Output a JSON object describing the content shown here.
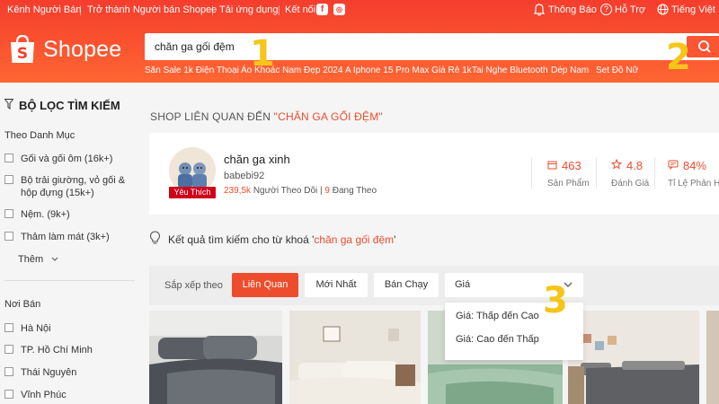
{
  "topbar": {
    "seller_center": "Kênh Người Bán",
    "become_seller": "Trở thành Người bán Shopee",
    "download_app": "Tải ứng dụng",
    "connect": "Kết nối",
    "notifications": "Thông Báo",
    "support": "Hỗ Trợ",
    "language": "Tiếng Việt"
  },
  "logo": {
    "text": "Shopee"
  },
  "search": {
    "query": "chăn ga gối đệm",
    "suggestions": [
      "Săn Sale 1k Điện Thoại",
      "Áo Khoác Nam Đẹp 2024",
      "A Iphone 15 Pro Max Giá Rẻ 1k",
      "Tai Nghe Bluetooth",
      "Dép Nam",
      "Set Đồ Nữ"
    ]
  },
  "annotations": [
    "1",
    "2",
    "3"
  ],
  "sidebar": {
    "title": "BỘ LỌC TÌM KIẾM",
    "category_title": "Theo Danh Mục",
    "categories": [
      "Gối và gối ôm (16k+)",
      "Bộ trải giường, vỏ gối &",
      "hộp đựng (15k+)",
      "Nệm. (9k+)",
      "Thảm làm mát (3k+)"
    ],
    "more": "Thêm",
    "seller_location_title": "Nơi Bán",
    "locations": [
      "Hà Nội",
      "TP. Hồ Chí Minh",
      "Thái Nguyên",
      "Vĩnh Phúc"
    ]
  },
  "related": {
    "prefix": "SHOP LIÊN QUAN ĐẾN ",
    "term": "\"CHĂN GA GỐI ĐỆM\""
  },
  "shop": {
    "name": "chăn ga xinh",
    "username": "babebi92",
    "badge": "Yêu Thích",
    "followers_value": "239,5k",
    "followers_label": "Người Theo Dõi",
    "following_value": "9",
    "following_label": "Đang Theo",
    "stats": [
      {
        "value": "463",
        "label": "Sản Phẩm",
        "icon": "box-icon"
      },
      {
        "value": "4.8",
        "label": "Đánh Giá",
        "icon": "star-icon"
      },
      {
        "value": "84%",
        "label": "Tỉ Lệ Phản Hồ",
        "icon": "chat-icon"
      }
    ]
  },
  "result": {
    "prefix": "Kết quả tìm kiếm cho từ khoá '",
    "term": "chăn ga gối đệm",
    "suffix": "'"
  },
  "sort": {
    "label": "Sắp xếp theo",
    "options": [
      "Liên Quan",
      "Mới Nhất",
      "Bán Chạy"
    ],
    "active_index": 0,
    "price_label": "Giá",
    "price_options": [
      "Giá: Thấp đến Cao",
      "Giá: Cao đến Thấp"
    ]
  },
  "colors": {
    "brand": "#ee4d2d",
    "header_top": "#f53d2d",
    "header_bottom": "#ff6633",
    "annotation": "#f5c518"
  }
}
